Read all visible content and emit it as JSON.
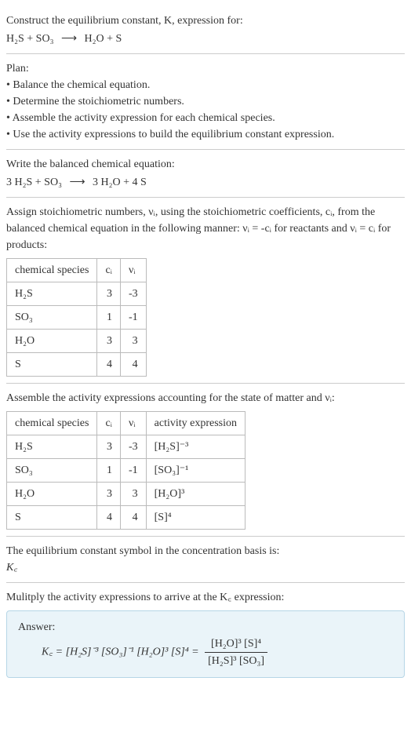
{
  "header": {
    "prompt": "Construct the equilibrium constant, K, expression for:",
    "equation_left": "H₂S + SO₃",
    "equation_right": "H₂O + S"
  },
  "plan": {
    "title": "Plan:",
    "b1": "• Balance the chemical equation.",
    "b2": "• Determine the stoichiometric numbers.",
    "b3": "• Assemble the activity expression for each chemical species.",
    "b4": "• Use the activity expressions to build the equilibrium constant expression."
  },
  "balanced": {
    "title": "Write the balanced chemical equation:",
    "left": "3 H₂S + SO₃",
    "right": "3 H₂O + 4 S"
  },
  "stoich": {
    "intro_a": "Assign stoichiometric numbers, νᵢ, using the stoichiometric coefficients, cᵢ, from the balanced chemical equation in the following manner: νᵢ = -cᵢ for reactants and νᵢ = cᵢ for products:",
    "h1": "chemical species",
    "h2": "cᵢ",
    "h3": "νᵢ",
    "r1c1": "H₂S",
    "r1c2": "3",
    "r1c3": "-3",
    "r2c1": "SO₃",
    "r2c2": "1",
    "r2c3": "-1",
    "r3c1": "H₂O",
    "r3c2": "3",
    "r3c3": "3",
    "r4c1": "S",
    "r4c2": "4",
    "r4c3": "4"
  },
  "activity": {
    "intro": "Assemble the activity expressions accounting for the state of matter and νᵢ:",
    "h1": "chemical species",
    "h2": "cᵢ",
    "h3": "νᵢ",
    "h4": "activity expression",
    "r1c1": "H₂S",
    "r1c2": "3",
    "r1c3": "-3",
    "r1c4": "[H₂S]⁻³",
    "r2c1": "SO₃",
    "r2c2": "1",
    "r2c3": "-1",
    "r2c4": "[SO₃]⁻¹",
    "r3c1": "H₂O",
    "r3c2": "3",
    "r3c3": "3",
    "r3c4": "[H₂O]³",
    "r4c1": "S",
    "r4c2": "4",
    "r4c3": "4",
    "r4c4": "[S]⁴"
  },
  "symbol": {
    "line1": "The equilibrium constant symbol in the concentration basis is:",
    "line2": "K꜀"
  },
  "multiply": {
    "line": "Mulitply the activity expressions to arrive at the K꜀ expression:"
  },
  "answer": {
    "label": "Answer:",
    "lhs": "K꜀ = [H₂S]⁻³ [SO₃]⁻¹ [H₂O]³ [S]⁴ =",
    "frac_top": "[H₂O]³ [S]⁴",
    "frac_bot": "[H₂S]³ [SO₃]"
  },
  "chart_data": {
    "type": "table",
    "title": "Stoichiometric numbers and activity expressions for H₂S + SO₃ → H₂O + S",
    "tables": [
      {
        "name": "stoichiometric_numbers",
        "columns": [
          "chemical species",
          "c_i",
          "v_i"
        ],
        "rows": [
          [
            "H2S",
            3,
            -3
          ],
          [
            "SO3",
            1,
            -1
          ],
          [
            "H2O",
            3,
            3
          ],
          [
            "S",
            4,
            4
          ]
        ]
      },
      {
        "name": "activity_expressions",
        "columns": [
          "chemical species",
          "c_i",
          "v_i",
          "activity expression"
        ],
        "rows": [
          [
            "H2S",
            3,
            -3,
            "[H2S]^-3"
          ],
          [
            "SO3",
            1,
            -1,
            "[SO3]^-1"
          ],
          [
            "H2O",
            3,
            3,
            "[H2O]^3"
          ],
          [
            "S",
            4,
            4,
            "[S]^4"
          ]
        ]
      }
    ],
    "balanced_equation": "3 H2S + SO3 -> 3 H2O + 4 S",
    "equilibrium_constant": "Kc = ([H2O]^3 [S]^4) / ([H2S]^3 [SO3])"
  }
}
